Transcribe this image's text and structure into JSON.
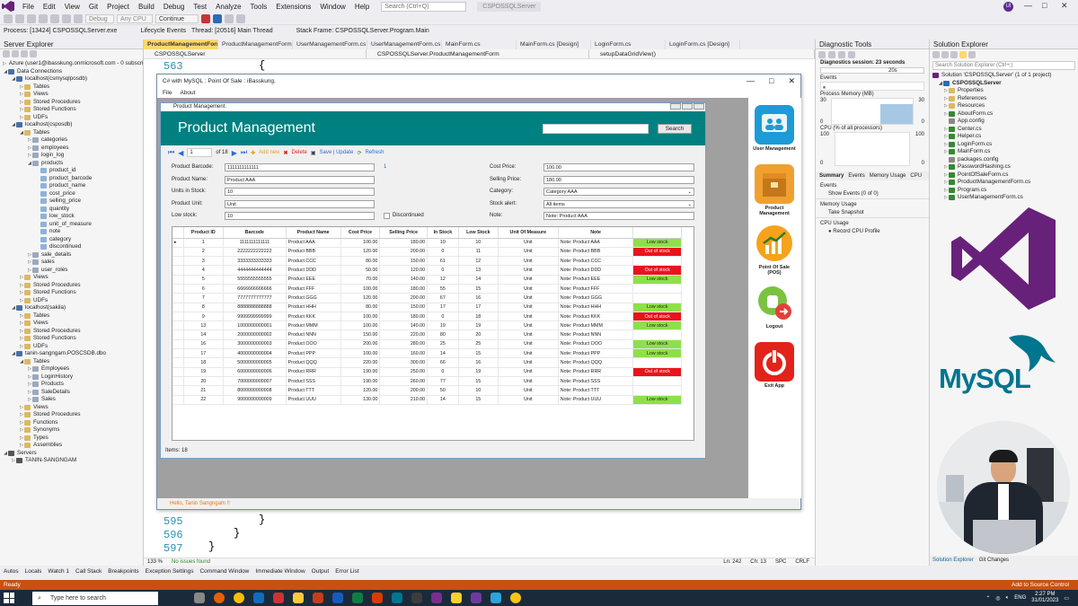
{
  "menubar": {
    "items": [
      "File",
      "Edit",
      "View",
      "Git",
      "Project",
      "Build",
      "Debug",
      "Test",
      "Analyze",
      "Tools",
      "Extensions",
      "Window",
      "Help"
    ],
    "search_placeholder": "Search (Ctrl+Q)",
    "solution_name": "CSPOSSQLServer",
    "user_initials": "UI"
  },
  "toolbar": {
    "config": "Debug",
    "platform": "Any CPU",
    "continue": "Continue",
    "process": "Process: [13424] CSPOSSQLServer.exe",
    "lifecycle": "Lifecycle Events",
    "thread": "Thread: [20516] Main Thread",
    "stackframe": "Stack Frame: CSPOSSQLServer.Program.Main"
  },
  "server_explorer": {
    "title": "Server Explorer",
    "nodes": [
      {
        "d": 0,
        "t": "Azure (user1@ibasskung.onmicrosoft.com - 0 subscri",
        "i": "db"
      },
      {
        "d": 0,
        "t": "Data Connections",
        "i": "db",
        "open": true
      },
      {
        "d": 1,
        "t": "localhost(csmysqlposdb)",
        "i": "db",
        "open": true
      },
      {
        "d": 2,
        "t": "Tables",
        "i": "fold"
      },
      {
        "d": 2,
        "t": "Views",
        "i": "fold"
      },
      {
        "d": 2,
        "t": "Stored Procedures",
        "i": "fold"
      },
      {
        "d": 2,
        "t": "Stored Functions",
        "i": "fold"
      },
      {
        "d": 2,
        "t": "UDFs",
        "i": "fold"
      },
      {
        "d": 1,
        "t": "localhost(csposdb)",
        "i": "db",
        "open": true
      },
      {
        "d": 2,
        "t": "Tables",
        "i": "fold",
        "open": true
      },
      {
        "d": 3,
        "t": "categories",
        "i": "tab"
      },
      {
        "d": 3,
        "t": "employees",
        "i": "tab"
      },
      {
        "d": 3,
        "t": "login_log",
        "i": "tab"
      },
      {
        "d": 3,
        "t": "products",
        "i": "tab",
        "open": true
      },
      {
        "d": 4,
        "t": "product_id",
        "i": "col"
      },
      {
        "d": 4,
        "t": "product_barcode",
        "i": "col"
      },
      {
        "d": 4,
        "t": "product_name",
        "i": "col"
      },
      {
        "d": 4,
        "t": "cost_price",
        "i": "col"
      },
      {
        "d": 4,
        "t": "selling_price",
        "i": "col"
      },
      {
        "d": 4,
        "t": "quantity",
        "i": "col"
      },
      {
        "d": 4,
        "t": "low_stock",
        "i": "col"
      },
      {
        "d": 4,
        "t": "unit_of_measure",
        "i": "col"
      },
      {
        "d": 4,
        "t": "note",
        "i": "col"
      },
      {
        "d": 4,
        "t": "category",
        "i": "col"
      },
      {
        "d": 4,
        "t": "discontinued",
        "i": "col"
      },
      {
        "d": 3,
        "t": "sale_details",
        "i": "tab"
      },
      {
        "d": 3,
        "t": "sales",
        "i": "tab"
      },
      {
        "d": 3,
        "t": "user_roles",
        "i": "tab"
      },
      {
        "d": 2,
        "t": "Views",
        "i": "fold"
      },
      {
        "d": 2,
        "t": "Stored Procedures",
        "i": "fold"
      },
      {
        "d": 2,
        "t": "Stored Functions",
        "i": "fold"
      },
      {
        "d": 2,
        "t": "UDFs",
        "i": "fold"
      },
      {
        "d": 1,
        "t": "localhost(sakila)",
        "i": "db",
        "open": true
      },
      {
        "d": 2,
        "t": "Tables",
        "i": "fold"
      },
      {
        "d": 2,
        "t": "Views",
        "i": "fold"
      },
      {
        "d": 2,
        "t": "Stored Procedures",
        "i": "fold"
      },
      {
        "d": 2,
        "t": "Stored Functions",
        "i": "fold"
      },
      {
        "d": 2,
        "t": "UDFs",
        "i": "fold"
      },
      {
        "d": 1,
        "t": "tanin-sangngam.POSCSDB.dbo",
        "i": "db",
        "open": true
      },
      {
        "d": 2,
        "t": "Tables",
        "i": "fold",
        "open": true
      },
      {
        "d": 3,
        "t": "Employees",
        "i": "tab"
      },
      {
        "d": 3,
        "t": "LoginHistory",
        "i": "tab"
      },
      {
        "d": 3,
        "t": "Products",
        "i": "tab"
      },
      {
        "d": 3,
        "t": "SaleDetails",
        "i": "tab"
      },
      {
        "d": 3,
        "t": "Sales",
        "i": "tab"
      },
      {
        "d": 2,
        "t": "Views",
        "i": "fold"
      },
      {
        "d": 2,
        "t": "Stored Procedures",
        "i": "fold"
      },
      {
        "d": 2,
        "t": "Functions",
        "i": "fold"
      },
      {
        "d": 2,
        "t": "Synonyms",
        "i": "fold"
      },
      {
        "d": 2,
        "t": "Types",
        "i": "fold"
      },
      {
        "d": 2,
        "t": "Assemblies",
        "i": "fold"
      },
      {
        "d": 0,
        "t": "Servers",
        "i": "srv",
        "open": true
      },
      {
        "d": 1,
        "t": "TANIN-SANGNGAM",
        "i": "srv"
      }
    ]
  },
  "doc_tabs": [
    "ProductManagementForm.cs",
    "ProductManagementForm.cs [Design]",
    "UserManagementForm.cs",
    "UserManagementForm.cs [Design]",
    "MainForm.cs",
    "MainForm.cs [Design]",
    "LoginForm.cs",
    "LoginForm.cs [Design]"
  ],
  "navbar": {
    "project": "CSPOSSQLServer",
    "class": "CSPOSSQLServer.ProductManagementForm",
    "member": "setupDataGridView()"
  },
  "editor": {
    "top_line": "563",
    "top_code": "{",
    "bottom_lines": [
      {
        "n": "595",
        "c": "}"
      },
      {
        "n": "596",
        "c": "}"
      },
      {
        "n": "597",
        "c": "}"
      }
    ],
    "zoom": "133 %",
    "issues": "No issues found",
    "ln": "Ln: 242",
    "ch": "Ch: 13",
    "enc": "SPC",
    "eol": "CRLF"
  },
  "app": {
    "title": "C# with MySQL : Point Of Sale : iBasskung.",
    "menu": [
      "File",
      "About"
    ],
    "status": "Hello, Tanin Sangngam !!",
    "side": [
      {
        "label": "User Management",
        "icon": "users-icon"
      },
      {
        "label": "Product Management",
        "icon": "box-icon"
      },
      {
        "label": "Point Of Sale (POS)",
        "icon": "chart-icon"
      },
      {
        "label": "Logout",
        "icon": "logout-icon"
      },
      {
        "label": "Exit App",
        "icon": "power-icon"
      }
    ]
  },
  "pm": {
    "window_title": "Product Management.",
    "heading": "Product Management",
    "search_label": "Search",
    "position": "1",
    "of": "of 18",
    "add": "Add new",
    "delete": "Delete",
    "save": "Save | Update",
    "refresh": "Refresh",
    "form": {
      "barcode_label": "Product Barcode:",
      "barcode": "1111111111111",
      "barcode_count": "1",
      "name_label": "Product Name:",
      "name": "Product AAA",
      "units_label": "Units in Stock:",
      "units": "10",
      "unit_label": "Product Unit:",
      "unit": "Unit",
      "low_label": "Low stock:",
      "low": "10",
      "disc_label": "Discontinued",
      "cost_label": "Cost Price:",
      "cost": "100.00",
      "sell_label": "Selling Price:",
      "sell": "180.00",
      "cat_label": "Category:",
      "cat": "Category AAA",
      "alert_label": "Stock alert:",
      "alert": "All items",
      "note_label": "Note:",
      "note": "Note: Product AAA"
    },
    "columns": [
      "Product ID",
      "Barcode",
      "Product Name",
      "Cost Price",
      "Selling Price",
      "In Stock",
      "Low Stock",
      "Unit Of Measure",
      "Note",
      ""
    ],
    "rows": [
      [
        "1",
        "1111111111111",
        "Product AAA",
        "100.00",
        "180.00",
        "10",
        "10",
        "Unit",
        "Note: Product AAA",
        "Low stock"
      ],
      [
        "2",
        "2222222222222",
        "Product BBB",
        "120.00",
        "200.00",
        "0",
        "11",
        "Unit",
        "Note: Product BBB",
        "Out of stock"
      ],
      [
        "3",
        "3333333333333",
        "Product CCC",
        "80.00",
        "150.00",
        "61",
        "12",
        "Unit",
        "Note: Product CCC",
        ""
      ],
      [
        "4",
        "4444444444444",
        "Product DDD",
        "50.00",
        "120.00",
        "0",
        "13",
        "Unit",
        "Note: Product DDD",
        "Out of stock"
      ],
      [
        "5",
        "5555555555555",
        "Product EEE",
        "70.00",
        "140.00",
        "12",
        "14",
        "Unit",
        "Note: Product EEE",
        "Low stock"
      ],
      [
        "6",
        "6666666666666",
        "Product FFF",
        "100.00",
        "180.00",
        "55",
        "15",
        "Unit",
        "Note: Product FFF",
        ""
      ],
      [
        "7",
        "7777777777777",
        "Product GGG",
        "120.00",
        "200.00",
        "67",
        "16",
        "Unit",
        "Note: Product GGG",
        ""
      ],
      [
        "8",
        "8888888888888",
        "Product HHH",
        "80.00",
        "150.00",
        "17",
        "17",
        "Unit",
        "Note: Product HHH",
        "Low stock"
      ],
      [
        "9",
        "9999999999999",
        "Product KKK",
        "100.00",
        "180.00",
        "0",
        "18",
        "Unit",
        "Note: Product KKK",
        "Out of stock"
      ],
      [
        "13",
        "1000000000001",
        "Product MMM",
        "100.00",
        "140.00",
        "19",
        "19",
        "Unit",
        "Note: Product MMM",
        "Low stock"
      ],
      [
        "14",
        "2000000000002",
        "Product NNN",
        "150.00",
        "220.00",
        "80",
        "20",
        "Unit",
        "Note: Product NNN",
        ""
      ],
      [
        "16",
        "3000000000003",
        "Product OOO",
        "200.00",
        "280.00",
        "25",
        "25",
        "Unit",
        "Note: Product OOO",
        "Low stock"
      ],
      [
        "17",
        "4000000000004",
        "Product PPP",
        "100.00",
        "160.00",
        "14",
        "15",
        "Unit",
        "Note: Product PPP",
        "Low stock"
      ],
      [
        "18",
        "5000000000005",
        "Product QQQ",
        "220.00",
        "300.00",
        "66",
        "16",
        "Unit",
        "Note: Product QQQ",
        ""
      ],
      [
        "19",
        "6000000000006",
        "Product RRR",
        "190.00",
        "250.00",
        "0",
        "19",
        "Unit",
        "Note: Product RRR",
        "Out of stock"
      ],
      [
        "20",
        "7000000000007",
        "Product SSS",
        "190.00",
        "260.00",
        "77",
        "15",
        "Unit",
        "Note: Product SSS",
        ""
      ],
      [
        "21",
        "8000000000008",
        "Product TTT",
        "120.00",
        "200.00",
        "50",
        "10",
        "Unit",
        "Note: Product TTT",
        ""
      ],
      [
        "22",
        "9000000000009",
        "Product UUU",
        "130.00",
        "210.00",
        "14",
        "15",
        "Unit",
        "Note: Product UUU",
        "Low stock"
      ]
    ],
    "items": "Items: 18"
  },
  "diag": {
    "title": "Diagnostic Tools",
    "session": "Diagnostics session: 23 seconds",
    "time": "20s",
    "events": "Events",
    "memory": "Process Memory (MB)",
    "mem_max": "30",
    "mem_min": "0",
    "cpu": "CPU (% of all processors)",
    "cpu_max": "100",
    "cpu_min": "0",
    "tabs": [
      "Summary",
      "Events",
      "Memory Usage",
      "CPU"
    ],
    "events_h": "Events",
    "show_events": "Show Events (0 of 0)",
    "mem_h": "Memory Usage",
    "snapshot": "Take Snapshot",
    "cpu_h": "CPU Usage",
    "record": "Record CPU Profile"
  },
  "sol": {
    "title": "Solution Explorer",
    "search": "Search Solution Explorer (Ctrl+;)",
    "root": "Solution 'CSPOSSQLServer' (1 of 1 project)",
    "project": "CSPOSSQLServer",
    "items": [
      "Properties",
      "References",
      "Resources",
      "AboutForm.cs",
      "App.config",
      "Center.cs",
      "Helper.cs",
      "LoginForm.cs",
      "MainForm.cs",
      "packages.config",
      "PasswordHashing.cs",
      "PointOfSaleForm.cs",
      "ProductManagementForm.cs",
      "Program.cs",
      "UserManagementForm.cs"
    ],
    "tabs": [
      "Solution Explorer",
      "Git Changes"
    ],
    "mysql": "MySQL"
  },
  "bottom_tabs": [
    "Autos",
    "Locals",
    "Watch 1",
    "Call Stack",
    "Breakpoints",
    "Exception Settings",
    "Command Window",
    "Immediate Window",
    "Output",
    "Error List"
  ],
  "status": {
    "ready": "Ready",
    "source_control": "Add to Source Control"
  },
  "taskbar": {
    "search": "Type here to search",
    "lang": "ENG",
    "time": "2:27 PM",
    "date": "31/01/2023"
  },
  "colors": {
    "teal": "#008080",
    "vs_purple": "#68217a",
    "status_orange": "#ca5010",
    "low_green": "#8ee04a",
    "out_red": "#e8141c"
  }
}
